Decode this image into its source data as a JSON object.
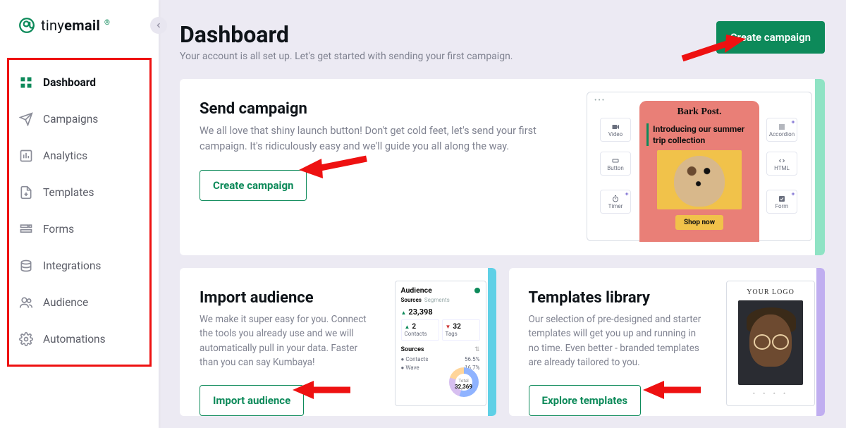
{
  "brand": {
    "name_thin": "tiny",
    "name_bold": "email"
  },
  "sidebar": {
    "items": [
      {
        "label": "Dashboard",
        "icon": "grid",
        "active": true
      },
      {
        "label": "Campaigns",
        "icon": "send",
        "active": false
      },
      {
        "label": "Analytics",
        "icon": "bar-chart",
        "active": false
      },
      {
        "label": "Templates",
        "icon": "file-plus",
        "active": false
      },
      {
        "label": "Forms",
        "icon": "form",
        "active": false
      },
      {
        "label": "Integrations",
        "icon": "stack",
        "active": false
      },
      {
        "label": "Audience",
        "icon": "users",
        "active": false
      },
      {
        "label": "Automations",
        "icon": "gear",
        "active": false
      }
    ]
  },
  "header": {
    "title": "Dashboard",
    "subtitle": "Your account is all set up. Let's get started with sending your first campaign.",
    "primary_button": "Create campaign"
  },
  "cards": {
    "send": {
      "title": "Send campaign",
      "desc": "We all love that shiny launch button! Don't get cold feet, let's send your first campaign. It's ridiculously easy and we'll guide you all along the way.",
      "button": "Create campaign"
    },
    "import": {
      "title": "Import audience",
      "desc": "We make it super easy for you. Connect the tools you already use and we will automatically pull in your data. Faster than you can say Kumbaya!",
      "button": "Import audience"
    },
    "templates": {
      "title": "Templates library",
      "desc": "Our selection of pre-designed and starter templates will get you up and running in no time. Even better - branded templates are already tailored to you.",
      "button": "Explore templates"
    }
  },
  "preview1": {
    "brand": "Bark Post.",
    "headline": "Introducing our summer trip collection",
    "cta": "Shop now",
    "chips": {
      "video": "Video",
      "button": "Button",
      "timer": "Timer",
      "accordion": "Accordion",
      "html": "HTML",
      "form": "Form"
    }
  },
  "preview2": {
    "title": "Audience",
    "tab_a": "Sources",
    "tab_b": "Segments",
    "total": "23,398",
    "box_a_label": "Contacts",
    "box_a_value": "2",
    "box_b_label": "Tags",
    "box_b_value": "32",
    "sources_title": "Sources",
    "row1_name": "Contacts",
    "row1_pct": "56.5%",
    "row2_name": "Wave",
    "row2_pct": "16.7%",
    "donut_total": "32,369",
    "donut_label": "Total"
  },
  "preview3": {
    "logo_text": "YOUR LOGO"
  }
}
